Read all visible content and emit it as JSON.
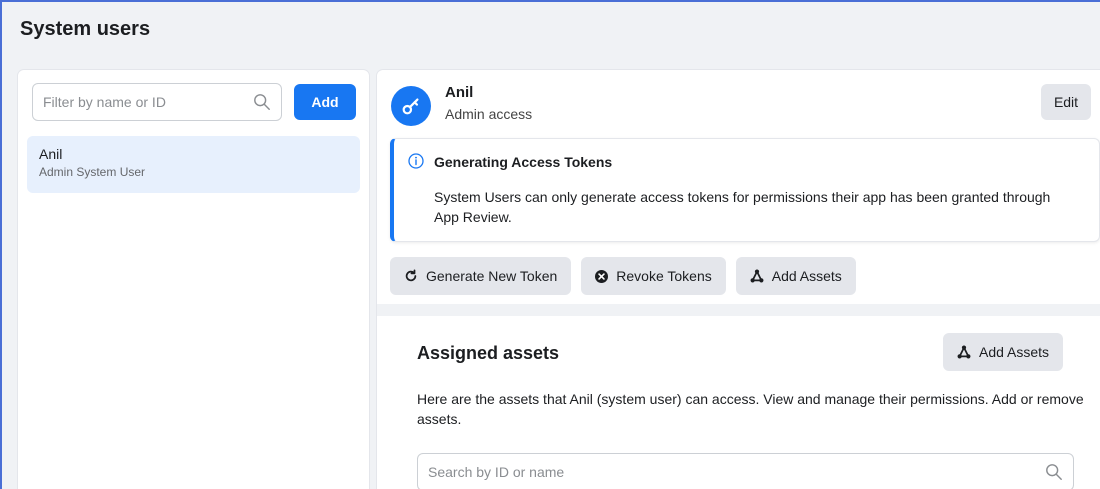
{
  "page": {
    "title": "System users"
  },
  "left": {
    "filter_placeholder": "Filter by name or ID",
    "add_label": "Add",
    "users": [
      {
        "name": "Anil",
        "role": "Admin System User"
      }
    ]
  },
  "detail": {
    "name": "Anil",
    "access": "Admin access",
    "edit_label": "Edit",
    "notice": {
      "title": "Generating Access Tokens",
      "body": "System Users can only generate access tokens for permissions their app has been granted through App Review."
    },
    "actions": {
      "generate": "Generate New Token",
      "revoke": "Revoke Tokens",
      "add_assets": "Add Assets"
    },
    "assets": {
      "title": "Assigned assets",
      "add_label": "Add Assets",
      "description": "Here are the assets that Anil (system user) can access. View and manage their permissions. Add or remove assets.",
      "search_placeholder": "Search by ID or name"
    }
  },
  "colors": {
    "accent": "#1877f2",
    "selected_row": "#e7f0fd",
    "secondary_button": "#e4e6eb",
    "background": "#f0f2f5"
  },
  "icons": {
    "avatar": "key-icon",
    "notice": "info-icon",
    "generate": "refresh-icon",
    "revoke": "close-circle-icon",
    "add_assets": "assets-icon",
    "search": "search-icon"
  }
}
